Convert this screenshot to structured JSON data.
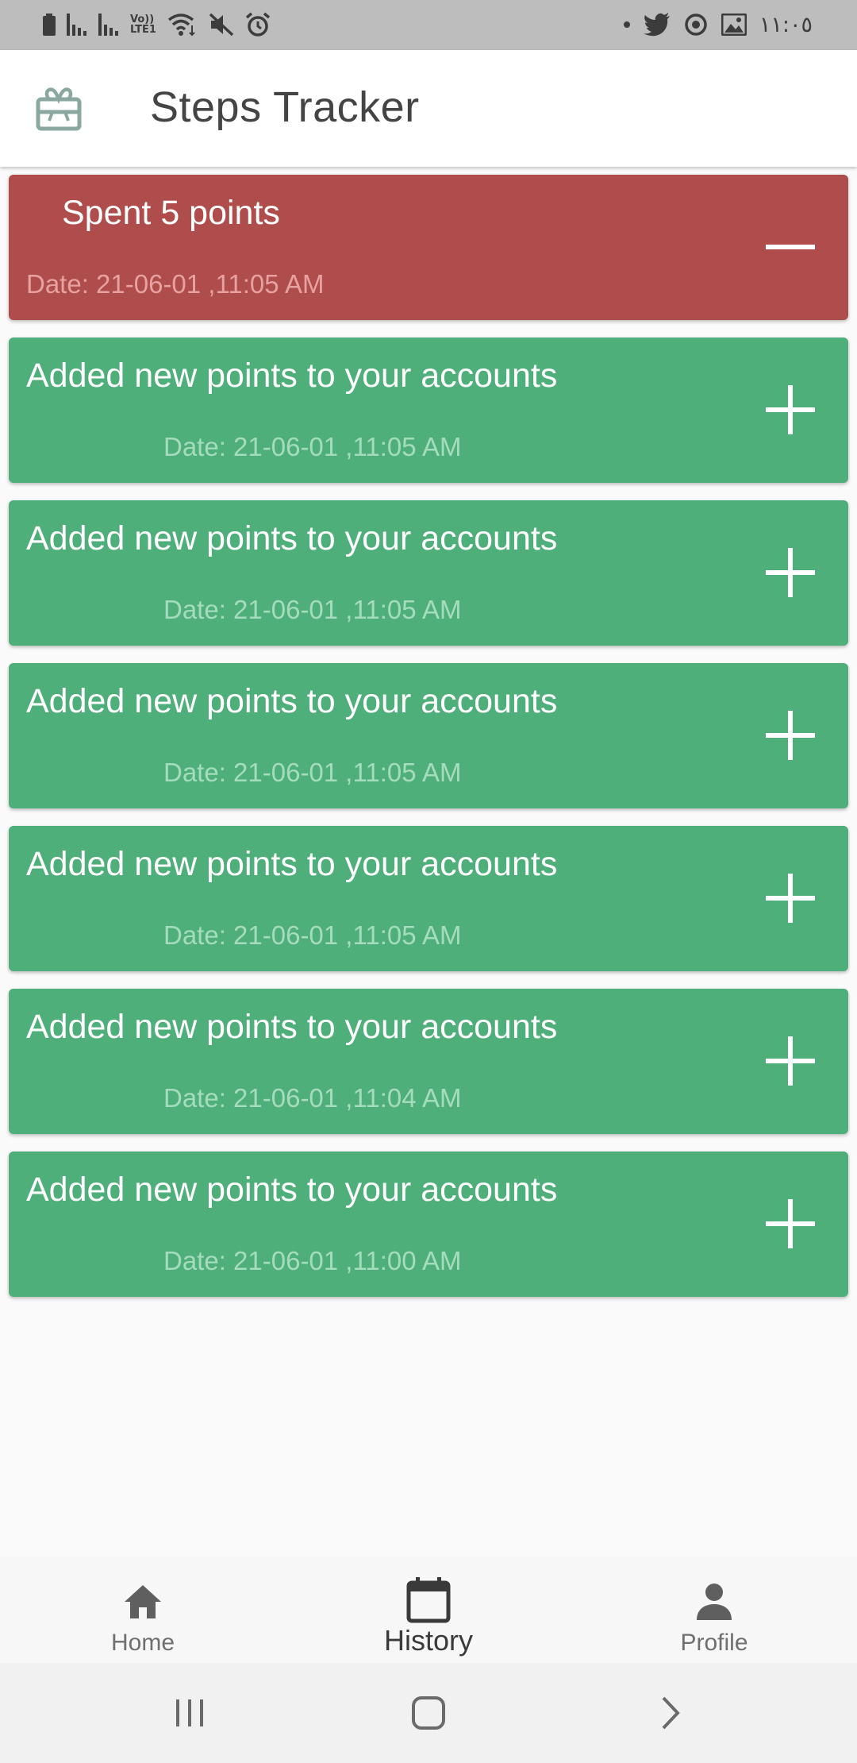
{
  "status_bar": {
    "time": "١١:٠٥",
    "network_label_top": "Vo))",
    "network_label_bottom": "LTE1",
    "left_icons": [
      "battery-icon",
      "signal-icon",
      "signal-icon",
      "volte-lte-icon",
      "wifi-icon",
      "mute-icon",
      "alarm-icon"
    ],
    "right_icons": [
      "notification-dot-icon",
      "twitter-icon",
      "sync-icon",
      "image-icon"
    ]
  },
  "app_bar": {
    "title": "Steps Tracker",
    "logo_icon": "gift-card-icon"
  },
  "history": [
    {
      "type": "spent",
      "title": "Spent 5 points",
      "date": "Date: 21-06-01 ,11:05 AM",
      "icon": "minus-icon"
    },
    {
      "type": "added",
      "title": "Added new points to your accounts",
      "date": "Date: 21-06-01 ,11:05 AM",
      "icon": "plus-icon"
    },
    {
      "type": "added",
      "title": "Added new points to your accounts",
      "date": "Date: 21-06-01 ,11:05 AM",
      "icon": "plus-icon"
    },
    {
      "type": "added",
      "title": "Added new points to your accounts",
      "date": "Date: 21-06-01 ,11:05 AM",
      "icon": "plus-icon"
    },
    {
      "type": "added",
      "title": "Added new points to your accounts",
      "date": "Date: 21-06-01 ,11:05 AM",
      "icon": "plus-icon"
    },
    {
      "type": "added",
      "title": "Added new points to your accounts",
      "date": "Date: 21-06-01 ,11:04 AM",
      "icon": "plus-icon"
    },
    {
      "type": "added",
      "title": "Added new points to your accounts",
      "date": "Date: 21-06-01 ,11:00 AM",
      "icon": "plus-icon"
    }
  ],
  "bottom_nav": {
    "items": [
      {
        "label": "Home",
        "icon": "home-icon",
        "active": false
      },
      {
        "label": "History",
        "icon": "calendar-icon",
        "active": true
      },
      {
        "label": "Profile",
        "icon": "person-icon",
        "active": false
      }
    ]
  },
  "system_nav": {
    "buttons": [
      "recents-icon",
      "home-circle-icon",
      "back-icon"
    ]
  },
  "colors": {
    "spent_card": "#af4c4c",
    "added_card": "#4faf7a",
    "status_bar": "#bdbdbd",
    "title_text": "#444444"
  }
}
